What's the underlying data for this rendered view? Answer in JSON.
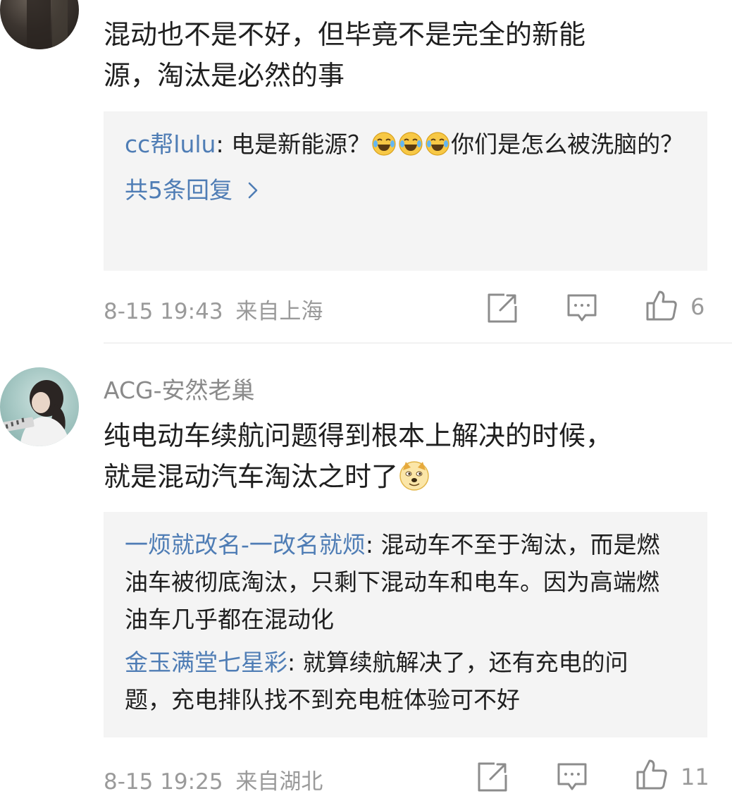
{
  "comments": [
    {
      "username": "",
      "text_lines": [
        "混动也不是不好，但毕竟不是完全的新能",
        "源，淘汰是必然的事"
      ],
      "replies": [
        {
          "name": "cc帮lulu",
          "text_before_emoji": ": 电是新能源？",
          "emoji": [
            "laugh-cry",
            "laugh-cry",
            "laugh-cry"
          ],
          "text_after_emoji": "你们是怎么被洗脑的？"
        }
      ],
      "more_replies": "共5条回复",
      "timestamp": "8-15 19:43",
      "location": "来自上海",
      "like_count": "6"
    },
    {
      "username": "ACG-安然老巢",
      "text_lines": [
        "纯电动车续航问题得到根本上解决的时候，",
        "就是混动汽车淘汰之时了"
      ],
      "text_emoji": "doge",
      "replies": [
        {
          "name": "一烦就改名-一改名就烦",
          "text": ": 混动车不至于淘汰，而是燃油车被彻底淘汰，只剩下混动车和电车。因为高端燃油车几乎都在混动化"
        },
        {
          "name": "金玉满堂七星彩",
          "text": ": 就算续航解决了，还有充电的问题，充电排队找不到充电桩体验可不好"
        }
      ],
      "timestamp": "8-15 19:25",
      "location": "来自湖北",
      "like_count": "11"
    }
  ],
  "icons": {
    "share": "share-icon",
    "comment": "comment-icon",
    "like": "thumbs-up-icon"
  },
  "colors": {
    "link": "#4f7db5",
    "meta": "#9a9a9a",
    "reply_bg": "#f4f4f4"
  }
}
